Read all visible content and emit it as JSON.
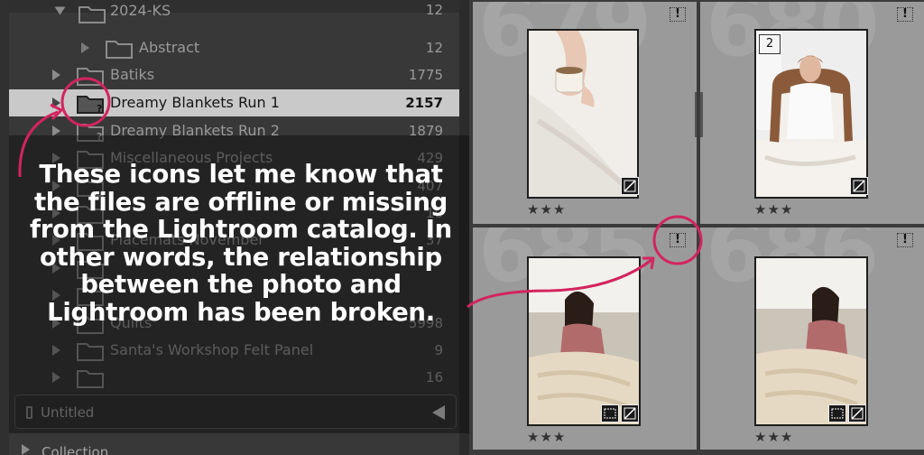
{
  "folders": [
    {
      "name": "2024-KS",
      "count": "12"
    },
    {
      "name": "Abstract",
      "count": "12"
    },
    {
      "name": "Batiks",
      "count": "1775"
    },
    {
      "name": "Dreamy Blankets Run 1",
      "count": "2157"
    },
    {
      "name": "Dreamy Blankets Run 2",
      "count": "1879"
    },
    {
      "name": "Miscellaneous Projects",
      "count": "429"
    },
    {
      "name": "",
      "count": "407"
    },
    {
      "name": "",
      "count": "10"
    },
    {
      "name": "Placemats November",
      "count": "37"
    },
    {
      "name": "",
      "count": ""
    },
    {
      "name": "",
      "count": ""
    },
    {
      "name": "Quilts",
      "count": "5998"
    },
    {
      "name": "Santa's Workshop Felt Panel",
      "count": "9"
    },
    {
      "name": "",
      "count": "16"
    }
  ],
  "untitled_label": "Untitled",
  "collections_label": "Collection",
  "caption": "These icons let me know that the files are offline or missing from the Lightroom catalog. In other words, the relationship between the photo and Lightroom has been broken.",
  "grid": {
    "cells": [
      {
        "number": "679",
        "flag": "!",
        "stars": "★★★"
      },
      {
        "number": "680",
        "flag": "!",
        "stars": "★★★",
        "page_badge": "2"
      },
      {
        "number": "685",
        "flag": "!",
        "stars": "★★★"
      },
      {
        "number": "686",
        "flag": "!",
        "stars": "★★★"
      }
    ]
  },
  "colors": {
    "accent": "#d3245f",
    "panel_bg": "#383838",
    "selected_row": "#c9c9c9",
    "cell_bg": "#9a9a9a"
  }
}
